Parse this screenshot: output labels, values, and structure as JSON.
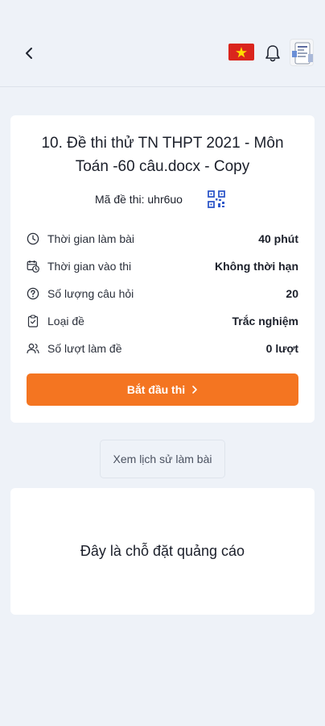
{
  "header": {
    "back_icon": "chevron-left-icon",
    "language_flag": "vietnam-flag",
    "notification_icon": "bell-icon",
    "avatar_icon": "avatar"
  },
  "exam": {
    "title": "10. Đề thi thử TN THPT 2021 - Môn Toán -60 câu.docx - Copy",
    "code_label": "Mã đề thi: uhr6uo",
    "qr_icon": "qr-code-icon",
    "info": [
      {
        "icon": "clock-icon",
        "label": "Thời gian làm bài",
        "value": "40 phút"
      },
      {
        "icon": "calendar-clock-icon",
        "label": "Thời gian vào thi",
        "value": "Không thời hạn"
      },
      {
        "icon": "question-circle-icon",
        "label": "Số lượng câu hỏi",
        "value": "20"
      },
      {
        "icon": "clipboard-icon",
        "label": "Loại đề",
        "value": "Trắc nghiệm"
      },
      {
        "icon": "users-icon",
        "label": "Số lượt làm đề",
        "value": "0 lượt"
      }
    ],
    "start_button": "Bắt đầu thi",
    "start_color": "#f47521"
  },
  "history_button": "Xem lịch sử làm bài",
  "ad": {
    "text": "Đây là chỗ đặt quảng cáo"
  }
}
